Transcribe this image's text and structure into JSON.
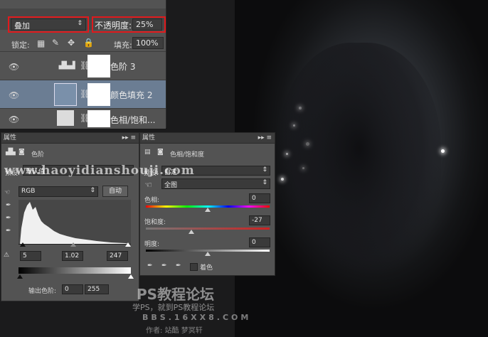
{
  "layers_panel": {
    "blend_mode": "叠加",
    "opacity_label": "不透明度:",
    "opacity_value": "25%",
    "lock_label": "锁定:",
    "fill_label": "填充:",
    "fill_value": "100%",
    "layers": [
      {
        "name": "色阶 3"
      },
      {
        "name": "颜色填充 2"
      },
      {
        "name": "色相/饱和..."
      }
    ]
  },
  "levels_panel": {
    "title": "属性",
    "subtitle": "色阶",
    "preset_label": "预设:",
    "preset_value": "默认值",
    "channel": "RGB",
    "auto_button": "自动",
    "input_black": "5",
    "input_gamma": "1.02",
    "input_white": "247",
    "output_label": "输出色阶:",
    "output_black": "0",
    "output_white": "255"
  },
  "huesat_panel": {
    "title": "属性",
    "subtitle": "色相/饱和度",
    "preset_label": "预设:",
    "preset_value": "自定",
    "range": "全图",
    "hue_label": "色相:",
    "hue_value": "0",
    "saturation_label": "饱和度:",
    "saturation_value": "-27",
    "lightness_label": "明度:",
    "lightness_value": "0",
    "colorize_label": "着色"
  },
  "watermarks": {
    "url": "www.haoyidianshouji.com",
    "site_name": "PS教程论坛",
    "site_slogan": "学PS，就到PS教程论坛",
    "site_url": "BBS.16XX8.COM",
    "author": "作者: 站酷 梦冥轩"
  },
  "colors": {
    "panel_bg": "#535353",
    "selected_layer": "#6b7d93",
    "highlight_red": "#e0191c"
  }
}
